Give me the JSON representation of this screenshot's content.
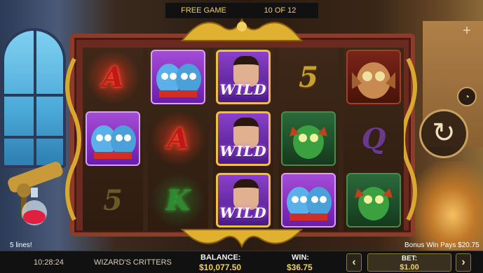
{
  "header": {
    "mode_label": "FREE GAME",
    "counter": "10 OF 12"
  },
  "reels": [
    [
      {
        "kind": "letter",
        "text": "A",
        "icon": "red-a-symbol"
      },
      {
        "kind": "tile",
        "icon": "twin-critters-symbol"
      },
      {
        "kind": "letter",
        "text": "5",
        "icon": "five-symbol"
      }
    ],
    [
      {
        "kind": "tile",
        "icon": "twin-critters-symbol"
      },
      {
        "kind": "letter",
        "text": "A",
        "icon": "red-a-symbol"
      },
      {
        "kind": "letter",
        "text": "K",
        "icon": "green-k-symbol"
      }
    ],
    [
      {
        "kind": "wild",
        "text": "WILD",
        "icon": "wizard-wild-symbol"
      },
      {
        "kind": "wild",
        "text": "WILD",
        "icon": "wizard-wild-symbol"
      },
      {
        "kind": "wild",
        "text": "WILD",
        "icon": "wizard-wild-symbol"
      }
    ],
    [
      {
        "kind": "letter",
        "text": "5",
        "icon": "five-symbol"
      },
      {
        "kind": "tile",
        "icon": "green-dragon-symbol"
      },
      {
        "kind": "tile",
        "icon": "twin-critters-symbol"
      }
    ],
    [
      {
        "kind": "tile",
        "icon": "owl-critter-symbol"
      },
      {
        "kind": "letter",
        "text": "Q",
        "icon": "purple-q-symbol"
      },
      {
        "kind": "tile",
        "icon": "green-dragon-symbol"
      }
    ]
  ],
  "status": {
    "lines": "5 lines!",
    "bonus": "Bonus Win Pays $20.75"
  },
  "footer": {
    "time": "10:28:24",
    "game_title": "WIZARD'S CRITTERS",
    "balance_label": "BALANCE:",
    "balance_value": "$10,077.50",
    "win_label": "WIN:",
    "win_value": "$36.75",
    "bet_label": "BET:",
    "bet_value": "$1.00"
  },
  "controls": {
    "plus_icon": "plus-icon",
    "speed_icon": "speedometer-icon",
    "spin_icon": "spin-icon",
    "prev_icon": "chevron-left-icon",
    "next_icon": "chevron-right-icon"
  }
}
